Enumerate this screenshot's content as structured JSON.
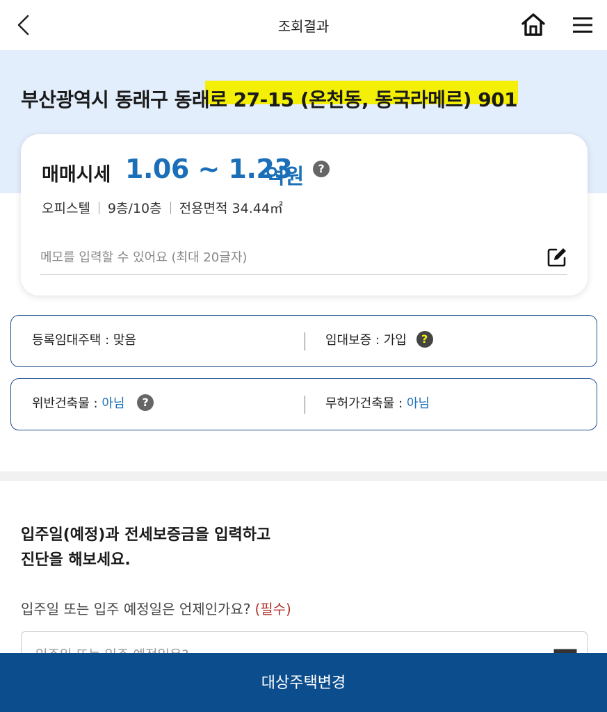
{
  "header": {
    "title": "조회결과"
  },
  "property": {
    "address": "부산광역시 동래구 동래로 27-15 (온천동, 동국라메르) 901",
    "price_label": "매매시세",
    "price_range": "1.06 ~ 1.23",
    "price_unit": "억원",
    "type": "오피스텔",
    "floor": "9층/10층",
    "area": "전용면적 34.44㎡",
    "memo_placeholder": "메모를 입력할 수 있어요 (최대 20글자)"
  },
  "info": {
    "registered_rental": {
      "label": "등록임대주택 : ",
      "value": "맞음"
    },
    "rental_guarantee": {
      "label": "임대보증 : ",
      "value": "가입"
    },
    "illegal_building": {
      "label": "위반건축물 : ",
      "value": "아님"
    },
    "unlicensed_building": {
      "label": "무허가건축물 : ",
      "value": "아님"
    }
  },
  "diagnosis": {
    "intro_line1": "입주일(예정)과 전세보증금을 입력하고",
    "intro_line2": "진단을 해보세요.",
    "question": "입주일 또는 입주 예정일은 언제인가요?",
    "required": "(필수)",
    "date_placeholder": "입주일 또는 입주 예정일은?"
  },
  "bottom_button": {
    "label": "대상주택변경"
  },
  "icons": {
    "help": "?"
  },
  "colors": {
    "accent_blue": "#1a6fb8",
    "band_bg": "#e3eefc",
    "button_bg": "#0c4d8e",
    "border_navy": "#1e4f86",
    "required_red": "#b0302a",
    "highlight": "#f4ef07"
  }
}
